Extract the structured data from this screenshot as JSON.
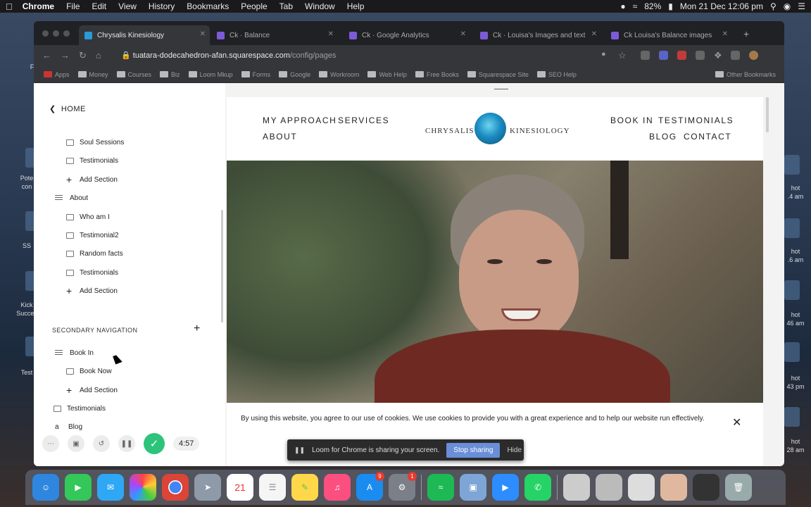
{
  "menubar": {
    "app": "Chrome",
    "items": [
      "File",
      "Edit",
      "View",
      "History",
      "Bookmarks",
      "People",
      "Tab",
      "Window",
      "Help"
    ],
    "battery": "82%",
    "datetime": "Mon 21 Dec  12:06 pm"
  },
  "desktop": {
    "labels": [
      "Fo",
      "Pote",
      "con",
      "SS",
      "Kick",
      "Succes",
      "Test",
      "hot",
      ".4 am",
      "hot",
      ".6 am",
      "hot",
      "46 am",
      "hot",
      "43 pm",
      "hot",
      "28 am"
    ]
  },
  "browser": {
    "tabs": [
      {
        "title": "Chrysalis Kinesiology"
      },
      {
        "title": "Ck · Balance"
      },
      {
        "title": "Ck · Google Analytics"
      },
      {
        "title": "Ck · Louisa's Images and text"
      },
      {
        "title": "Ck Louisa's Balance images"
      }
    ],
    "url_host": "tuatara-dodecahedron-afan.squarespace.com",
    "url_path": "/config/pages",
    "bookmarks": [
      "Apps",
      "Money",
      "Courses",
      "Biz",
      "Loom Mkup",
      "Forms",
      "Google",
      "Workroom",
      "Web Help",
      "Free Books",
      "Squarespace Site",
      "SEO Help",
      "Other Bookmarks"
    ]
  },
  "sidebar": {
    "home_label": "HOME",
    "items": [
      {
        "label": "Soul Sessions",
        "kind": "page"
      },
      {
        "label": "Testimonials",
        "kind": "page"
      },
      {
        "label": "Add Section",
        "kind": "add"
      },
      {
        "label": "About",
        "kind": "folder"
      },
      {
        "label": "Who am I",
        "kind": "page"
      },
      {
        "label": "Testimonial2",
        "kind": "page"
      },
      {
        "label": "Random facts",
        "kind": "page"
      },
      {
        "label": "Testimonials",
        "kind": "page"
      },
      {
        "label": "Add Section",
        "kind": "add"
      }
    ],
    "secondary_nav_title": "SECONDARY NAVIGATION",
    "secondary_items": [
      {
        "label": "Book In",
        "kind": "folder"
      },
      {
        "label": "Book Now",
        "kind": "page"
      },
      {
        "label": "Add Section",
        "kind": "add"
      },
      {
        "label": "Testimonials",
        "kind": "page-top"
      },
      {
        "label": "Blog",
        "kind": "blog"
      }
    ]
  },
  "loom": {
    "timer": "4:57"
  },
  "site": {
    "nav_left": [
      "MY APPROACH",
      "SERVICES",
      "ABOUT"
    ],
    "logo_left": "CHRYSALIS",
    "logo_right": "KINESIOLOGY",
    "nav_right": [
      "BOOK IN",
      "TESTIMONIALS",
      "BLOG",
      "CONTACT"
    ],
    "cookie_text": "By using this website, you agree to our use of cookies. We use cookies to provide you with a great experience and to help our website run effectively."
  },
  "share_bar": {
    "message": "Loom for Chrome is sharing your screen.",
    "stop": "Stop sharing",
    "hide": "Hide"
  },
  "dock": {
    "calendar_day": "21",
    "appstore_badge": "9",
    "prefs_badge": "1"
  }
}
